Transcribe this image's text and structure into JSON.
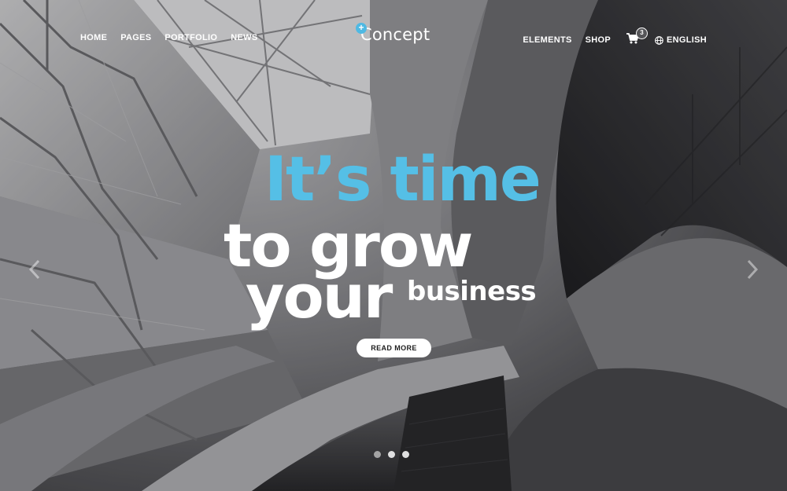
{
  "header": {
    "nav_left": [
      "HOME",
      "PAGES",
      "PORTFOLIO",
      "NEWS"
    ],
    "logo": {
      "mark": "+",
      "text": "Concept"
    },
    "nav_right": [
      "ELEMENTS",
      "SHOP"
    ],
    "cart_count": "3",
    "language": "ENGLISH"
  },
  "hero": {
    "line1": "It’s time",
    "line2": "to grow",
    "line3": "your",
    "line3_small": "business",
    "cta_label": "READ MORE",
    "slides_total": 3,
    "active_slide": 2
  },
  "colors": {
    "accent": "#55bfe6",
    "text": "#ffffff"
  },
  "icons": [
    "cart-icon",
    "globe-icon",
    "chevron-left-icon",
    "chevron-right-icon"
  ]
}
